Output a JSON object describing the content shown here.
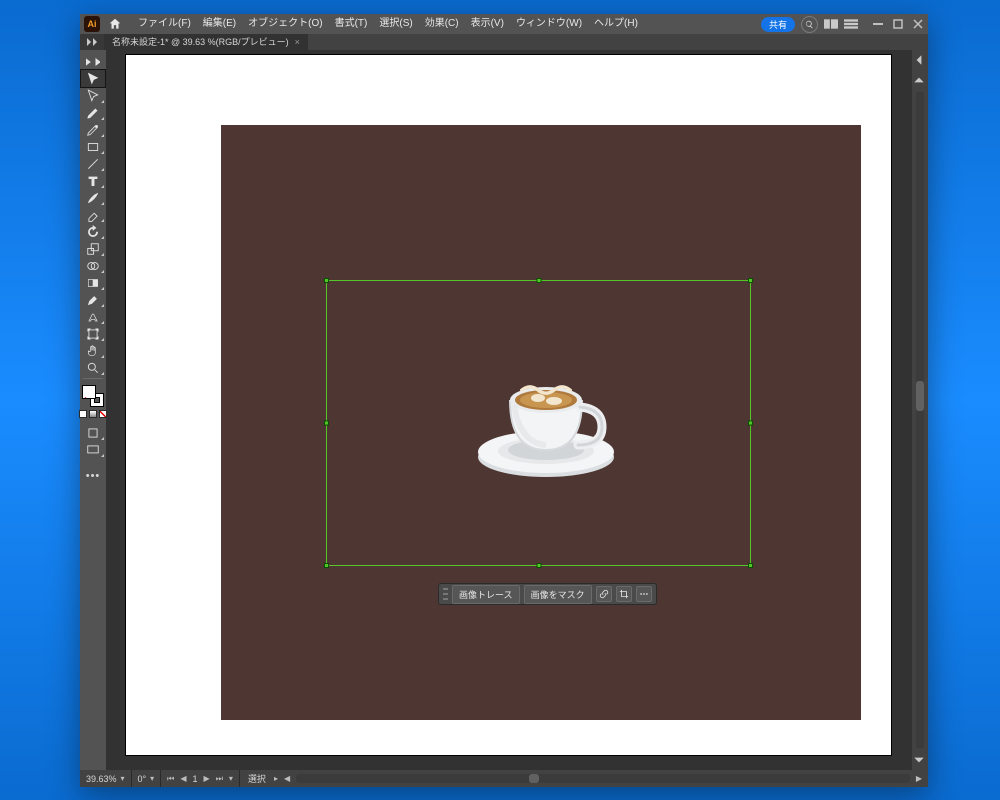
{
  "menubar": {
    "items": [
      "ファイル(F)",
      "編集(E)",
      "オブジェクト(O)",
      "書式(T)",
      "選択(S)",
      "効果(C)",
      "表示(V)",
      "ウィンドウ(W)",
      "ヘルプ(H)"
    ],
    "share_label": "共有"
  },
  "tab": {
    "title": "名称未設定-1* @ 39.63 %(RGB/プレビュー)"
  },
  "canvas": {
    "artboard_bg": "#4e3632",
    "selection_border": "#53c728"
  },
  "context_bar": {
    "trace_label": "画像トレース",
    "mask_label": "画像をマスク"
  },
  "statusbar": {
    "zoom": "39.63%",
    "rotate": "0°",
    "artboard_index": "1",
    "mode": "選択"
  },
  "tools": {
    "list": [
      "selection",
      "direct-selection",
      "pen",
      "curvature",
      "type",
      "line",
      "rectangle",
      "paintbrush",
      "shape-builder",
      "rotate",
      "scale",
      "width",
      "gradient",
      "eyedropper",
      "blend",
      "symbol-sprayer",
      "artboard",
      "slice",
      "hand",
      "zoom"
    ]
  }
}
